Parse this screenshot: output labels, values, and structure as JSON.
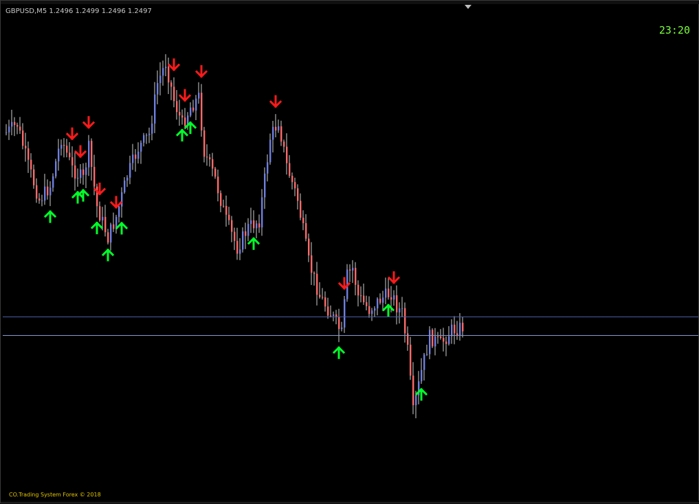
{
  "chart_header": {
    "symbol": "GBPUSD,M5",
    "ohlc": "1.2496 1.2499 1.2496 1.2497"
  },
  "clock": "23:20",
  "copyright": "CO.Trading System Forex © 2018",
  "colors": {
    "background": "#000000",
    "bull_candle": "#6f7fe0",
    "bear_candle": "#ff6a6a",
    "wick": "#d0d0d0",
    "buy_arrow": "#00ff2a",
    "sell_arrow": "#ff1a1a",
    "clock_text": "#7cff3c",
    "copyright_text": "#e3c500"
  },
  "chart_data": {
    "type": "candlestick",
    "symbol": "GBPUSD",
    "timeframe": "M5",
    "last_quote": {
      "open": 1.2496,
      "high": 1.2499,
      "low": 1.2496,
      "close": 1.2497
    },
    "signals": [
      {
        "type": "sell",
        "bar": 24
      },
      {
        "type": "sell",
        "bar": 27
      },
      {
        "type": "sell",
        "bar": 30
      },
      {
        "type": "sell",
        "bar": 34
      },
      {
        "type": "sell",
        "bar": 40
      },
      {
        "type": "sell",
        "bar": 61
      },
      {
        "type": "sell",
        "bar": 65
      },
      {
        "type": "sell",
        "bar": 71
      },
      {
        "type": "sell",
        "bar": 98
      },
      {
        "type": "sell",
        "bar": 123
      },
      {
        "type": "sell",
        "bar": 141
      },
      {
        "type": "buy",
        "bar": 16
      },
      {
        "type": "buy",
        "bar": 26
      },
      {
        "type": "buy",
        "bar": 28
      },
      {
        "type": "buy",
        "bar": 33
      },
      {
        "type": "buy",
        "bar": 37
      },
      {
        "type": "buy",
        "bar": 42
      },
      {
        "type": "buy",
        "bar": 64
      },
      {
        "type": "buy",
        "bar": 67
      },
      {
        "type": "buy",
        "bar": 90
      },
      {
        "type": "buy",
        "bar": 121
      },
      {
        "type": "buy",
        "bar": 139
      },
      {
        "type": "buy",
        "bar": 151
      }
    ]
  }
}
